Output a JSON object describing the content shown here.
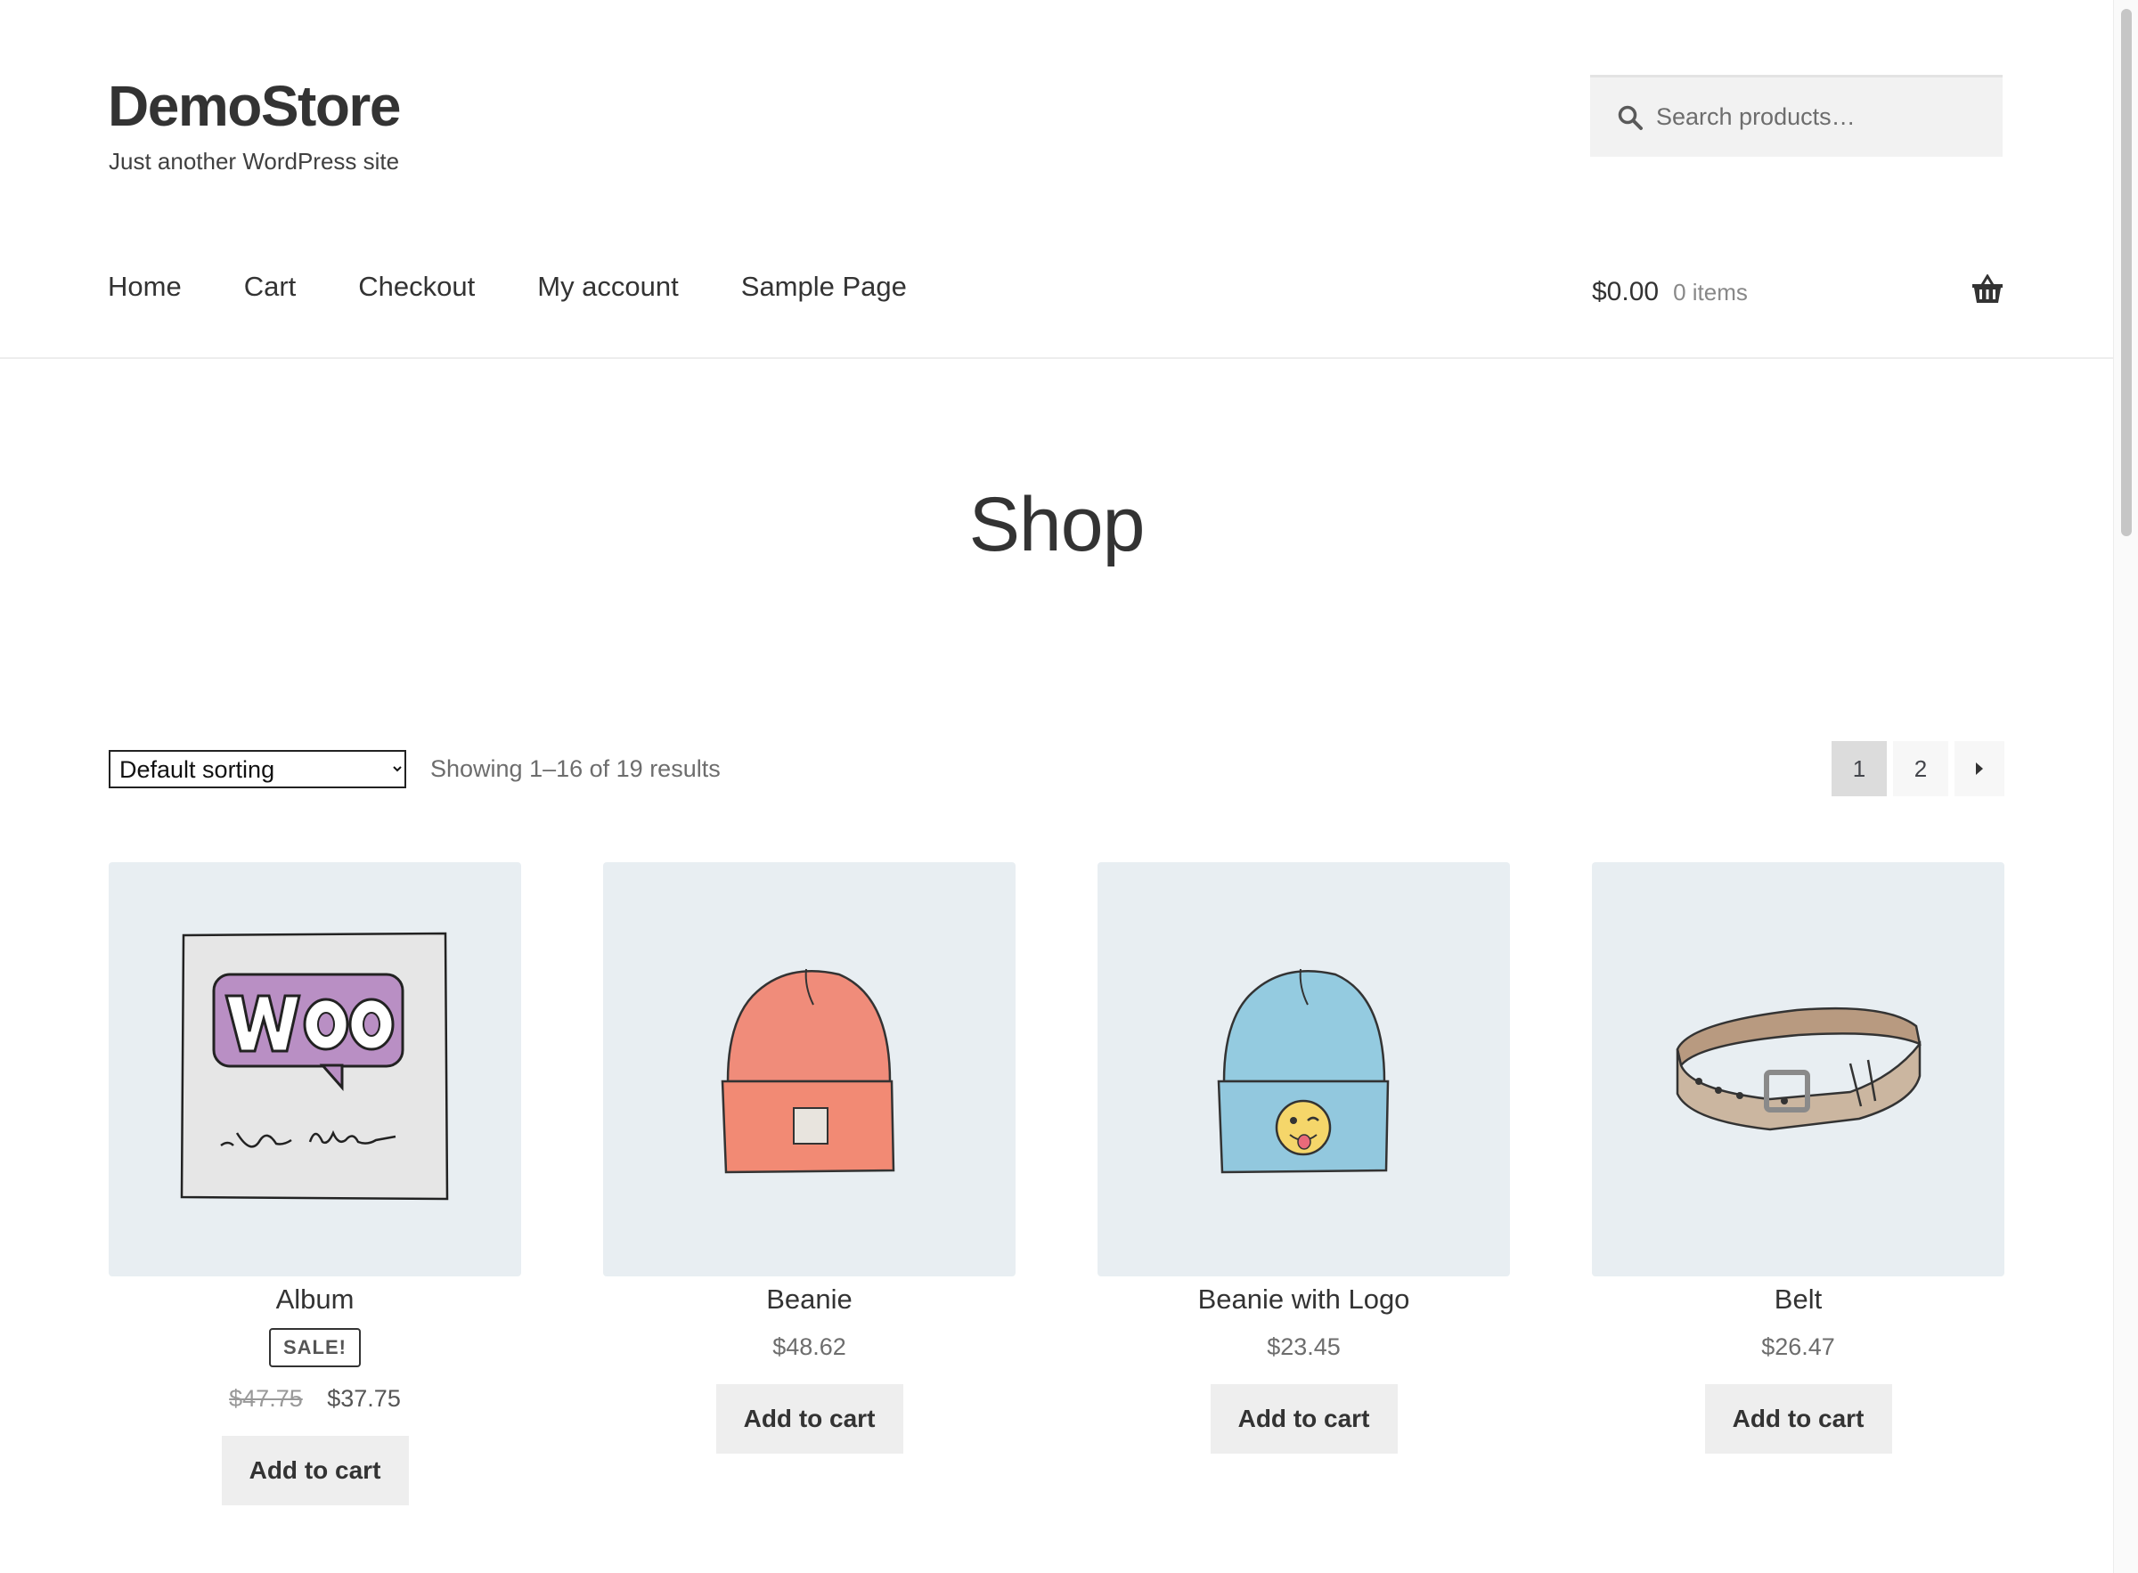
{
  "header": {
    "site_title": "DemoStore",
    "site_description": "Just another WordPress site",
    "search_placeholder": "Search products…"
  },
  "nav": {
    "items": [
      {
        "label": "Home"
      },
      {
        "label": "Cart"
      },
      {
        "label": "Checkout"
      },
      {
        "label": "My account"
      },
      {
        "label": "Sample Page"
      }
    ]
  },
  "cart": {
    "amount": "$0.00",
    "count": "0 items",
    "icon": "basket-icon"
  },
  "page": {
    "title": "Shop"
  },
  "toolbar": {
    "sort_selected": "Default sorting",
    "result_count": "Showing 1–16 of 19 results",
    "pages": [
      "1",
      "2"
    ],
    "current_page": "1"
  },
  "products": [
    {
      "name": "Album",
      "sale_badge": "SALE!",
      "old_price": "$47.75",
      "price": "$37.75",
      "button": "Add to cart",
      "image": "woo-album-icon"
    },
    {
      "name": "Beanie",
      "price": "$48.62",
      "button": "Add to cart",
      "image": "beanie-icon"
    },
    {
      "name": "Beanie with Logo",
      "price": "$23.45",
      "button": "Add to cart",
      "image": "beanie-logo-icon"
    },
    {
      "name": "Belt",
      "price": "$26.47",
      "button": "Add to cart",
      "image": "belt-icon"
    }
  ],
  "colors": {
    "thumb_bg": "#e8eef2",
    "button_bg": "#eeeeee",
    "text": "#333333"
  }
}
